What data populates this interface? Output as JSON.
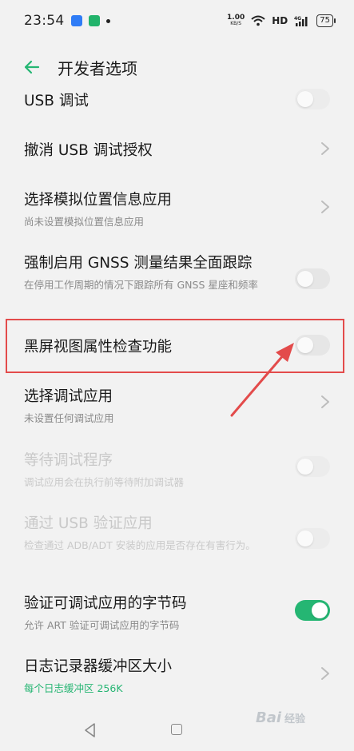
{
  "status_bar": {
    "time": "23:54",
    "net_speed_value": "1.00",
    "net_speed_unit": "KB/S",
    "hd_label": "HD",
    "battery_level": "75",
    "icons": [
      "app-notification-blue",
      "app-notification-green",
      "dot",
      "wifi",
      "signal-4g"
    ]
  },
  "header": {
    "title": "开发者选项"
  },
  "settings": [
    {
      "title": "USB 调试",
      "control": "toggle",
      "on": false
    },
    {
      "title": "撤消 USB 调试授权",
      "control": "chevron"
    },
    {
      "title": "选择模拟位置信息应用",
      "subtitle": "尚未设置模拟位置信息应用",
      "control": "chevron"
    },
    {
      "title": "强制启用 GNSS 测量结果全面跟踪",
      "subtitle": "在停用工作周期的情况下跟踪所有 GNSS 星座和频率",
      "control": "toggle",
      "on": false
    },
    {
      "title": "黑屏视图属性检查功能",
      "control": "toggle",
      "on": false
    },
    {
      "title": "选择调试应用",
      "subtitle": "未设置任何调试应用",
      "control": "chevron"
    },
    {
      "title": "等待调试程序",
      "subtitle": "调试应用会在执行前等待附加调试器",
      "control": "toggle",
      "on": false,
      "disabled": true
    },
    {
      "title": "通过 USB 验证应用",
      "subtitle": "检查通过 ADB/ADT 安装的应用是否存在有害行为。",
      "control": "toggle",
      "on": false,
      "disabled": true
    },
    {
      "title": "验证可调试应用的字节码",
      "subtitle": "允许 ART 验证可调试应用的字节码",
      "control": "toggle",
      "on": true
    },
    {
      "title": "日志记录器缓冲区大小",
      "subtitle": "每个日志缓冲区 256K",
      "control": "chevron",
      "subtitle_accent": true
    }
  ],
  "annotation": {
    "highlighted_item": "黑屏视图属性检查功能",
    "color": "#e34b4b"
  },
  "navbar": {
    "buttons": [
      "back",
      "home"
    ]
  },
  "watermark": {
    "text": "Bai",
    "suffix": "经验"
  },
  "colors": {
    "accent": "#25b673",
    "background": "#f2f2f2",
    "annotation_red": "#e34b4b"
  }
}
